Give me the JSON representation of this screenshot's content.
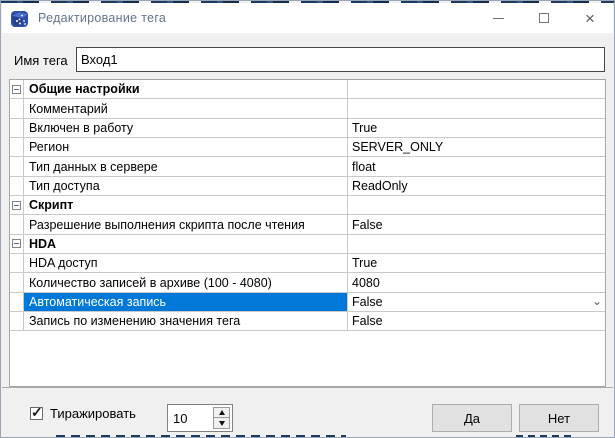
{
  "window": {
    "title": "Редактирование тега"
  },
  "tag_name": {
    "label": "Имя тега",
    "value": "Вход1"
  },
  "property_grid": {
    "rows": [
      {
        "type": "group",
        "label": "Общие настройки"
      },
      {
        "type": "prop",
        "label": "Комментарий",
        "value": ""
      },
      {
        "type": "prop",
        "label": "Включен в работу",
        "value": "True"
      },
      {
        "type": "prop",
        "label": "Регион",
        "value": "SERVER_ONLY"
      },
      {
        "type": "prop",
        "label": "Тип данных в сервере",
        "value": "float"
      },
      {
        "type": "prop",
        "label": "Тип доступа",
        "value": "ReadOnly"
      },
      {
        "type": "group",
        "label": "Скрипт"
      },
      {
        "type": "prop",
        "label": "Разрешение выполнения скрипта после чтения",
        "value": "False"
      },
      {
        "type": "group",
        "label": "HDA"
      },
      {
        "type": "prop",
        "label": "HDA доступ",
        "value": "True"
      },
      {
        "type": "prop",
        "label": "Количество записей в архиве (100 - 4080)",
        "value": "4080"
      },
      {
        "type": "prop",
        "label": "Автоматическая запись",
        "value": "False",
        "selected": true,
        "editor": "dropdown"
      },
      {
        "type": "prop",
        "label": "Запись по изменению значения тега",
        "value": "False"
      }
    ]
  },
  "footer": {
    "replicate_checkbox": {
      "label": "Тиражировать",
      "checked": true
    },
    "replicate_count": "10",
    "yes_label": "Да",
    "no_label": "Нет"
  },
  "icons": {
    "app-icon": "blue cube with white dots",
    "minimize-icon": "–",
    "maximize-icon": "□",
    "close-icon": "×",
    "collapse-minus-icon": "⊟",
    "chevron-down-icon": "⌄",
    "checkbox-check-icon": "✓",
    "spin-up-icon": "▲",
    "spin-down-icon": "▼"
  },
  "colors": {
    "selection_blue": "#0078d7",
    "titlebar_bg": "#ffffff",
    "dialog_bg": "#f0f0f0",
    "title_text": "#64748c",
    "app_icon_blue": "#2d50a7"
  }
}
